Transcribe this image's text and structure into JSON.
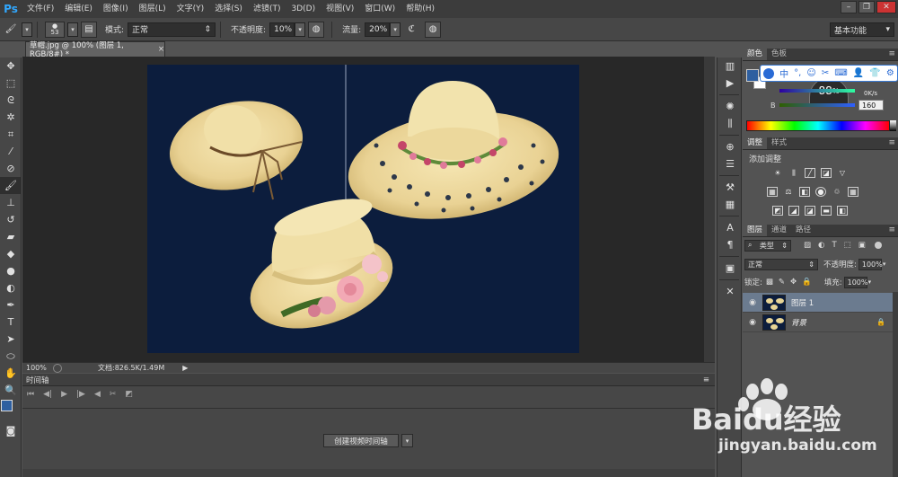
{
  "app": {
    "logo": "Ps"
  },
  "menu": [
    "文件(F)",
    "编辑(E)",
    "图像(I)",
    "图层(L)",
    "文字(Y)",
    "选择(S)",
    "滤镜(T)",
    "3D(D)",
    "视图(V)",
    "窗口(W)",
    "帮助(H)"
  ],
  "window_controls": {
    "minimize": "–",
    "restore": "❐",
    "close": "✕"
  },
  "options": {
    "brush_size": "53",
    "mode_label": "模式:",
    "mode_value": "正常",
    "opacity_label": "不透明度:",
    "opacity_value": "10%",
    "flow_label": "流量:",
    "flow_value": "20%",
    "workspace": "基本功能"
  },
  "document": {
    "tab_title": "草帽.jpg @ 100% (图层 1, RGB/8#) *",
    "tab_close": "×",
    "zoom": "100%",
    "doc_info": "文档:826.5K/1.49M"
  },
  "timeline": {
    "title": "时间轴",
    "create_button": "创建视频时间轴"
  },
  "color_panel": {
    "tabs": [
      "颜色",
      "色板"
    ],
    "fg_color": "#2e5fa0",
    "bg_color": "#ffffff",
    "b_label": "B",
    "b_value": "160",
    "ring_value": "88",
    "ring_unit": "%",
    "rate": "0K/s"
  },
  "ime_bar": {
    "items": [
      "中",
      "°,",
      "☺",
      "✂",
      "⌨",
      "👤",
      "👕",
      "⚙"
    ]
  },
  "adjust_panel": {
    "tabs": [
      "调整",
      "样式"
    ],
    "title": "添加调整"
  },
  "layers_panel": {
    "tabs": [
      "图层",
      "通道",
      "路径"
    ],
    "filter_kind": "类型",
    "blend_mode": "正常",
    "opacity_label": "不透明度:",
    "opacity_value": "100%",
    "lock_label": "锁定:",
    "fill_label": "填充:",
    "fill_value": "100%",
    "layers": [
      {
        "name": "图层 1",
        "selected": true
      },
      {
        "name": "背景",
        "selected": false,
        "locked": true
      }
    ]
  },
  "watermark": {
    "brand": "Baidu经验",
    "url": "jingyan.baidu.com"
  }
}
